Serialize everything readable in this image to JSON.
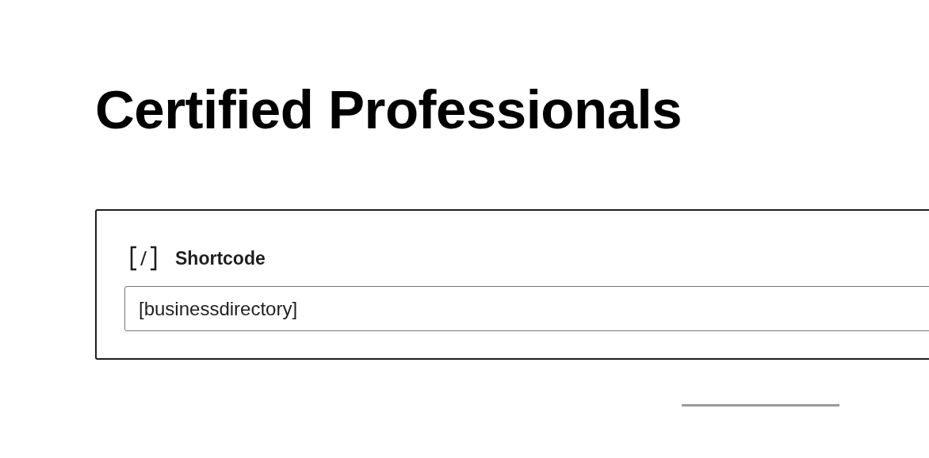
{
  "page": {
    "title": "Certified Professionals"
  },
  "block": {
    "label": "Shortcode",
    "value": "[businessdirectory]"
  }
}
